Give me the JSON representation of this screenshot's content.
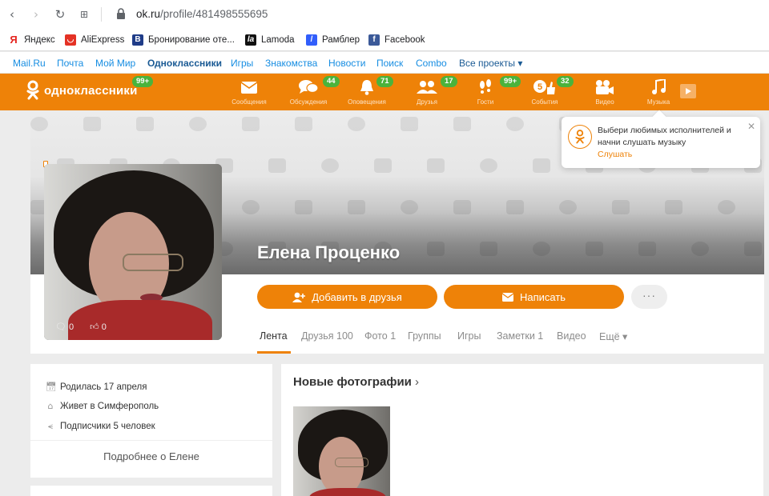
{
  "browser": {
    "url_domain": "ok.ru",
    "url_path": "/profile/481498555695",
    "bookmarks": [
      "Яндекс",
      "AliExpress",
      "Бронирование оте...",
      "Lamoda",
      "Рамблер",
      "Facebook"
    ]
  },
  "mailru_bar": {
    "links": [
      "Mail.Ru",
      "Почта",
      "Мой Мир",
      "Одноклассники",
      "Игры",
      "Знакомства",
      "Новости",
      "Поиск",
      "Combo",
      "Все проекты ▾"
    ]
  },
  "header": {
    "logo_text": "одноклассники",
    "logo_badge": "99+",
    "items": [
      {
        "label": "Сообщения",
        "icon": "envelope-icon",
        "badge": ""
      },
      {
        "label": "Обсуждения",
        "icon": "chat-icon",
        "badge": "44"
      },
      {
        "label": "Оповещения",
        "icon": "bell-icon",
        "badge": "71"
      },
      {
        "label": "Друзья",
        "icon": "friends-icon",
        "badge": "17"
      },
      {
        "label": "Гости",
        "icon": "footprints-icon",
        "badge": "99+"
      },
      {
        "label": "События",
        "icon": "events-icon",
        "badge": "32"
      },
      {
        "label": "Видео",
        "icon": "video-camera-icon",
        "badge": ""
      },
      {
        "label": "Музыка",
        "icon": "music-note-icon",
        "badge": ""
      }
    ],
    "accent": "#ee8208",
    "badge_color": "#4ab33c"
  },
  "profile": {
    "name": "Елена Проценко",
    "avatar_comments": "0",
    "avatar_likes": "0",
    "add_friend": "Добавить в друзья",
    "write": "Написать",
    "more": "···",
    "tabs": [
      "Лента",
      "Друзья 100",
      "Фото 1",
      "Группы",
      "Игры",
      "Заметки 1",
      "Видео",
      "Ещё ▾"
    ]
  },
  "info": {
    "born": "Родилась 17 апреля",
    "lives": "Живет в Симферополь",
    "subscribers": "Подписчики 5 человек",
    "more_link": "Подробнее о Елене"
  },
  "photos": {
    "title": "Новые фотографии",
    "arrow": "›"
  },
  "popup": {
    "text": "Выбери любимых исполнителей и начни слушать музыку",
    "link": "Слушать",
    "close": "✕"
  }
}
